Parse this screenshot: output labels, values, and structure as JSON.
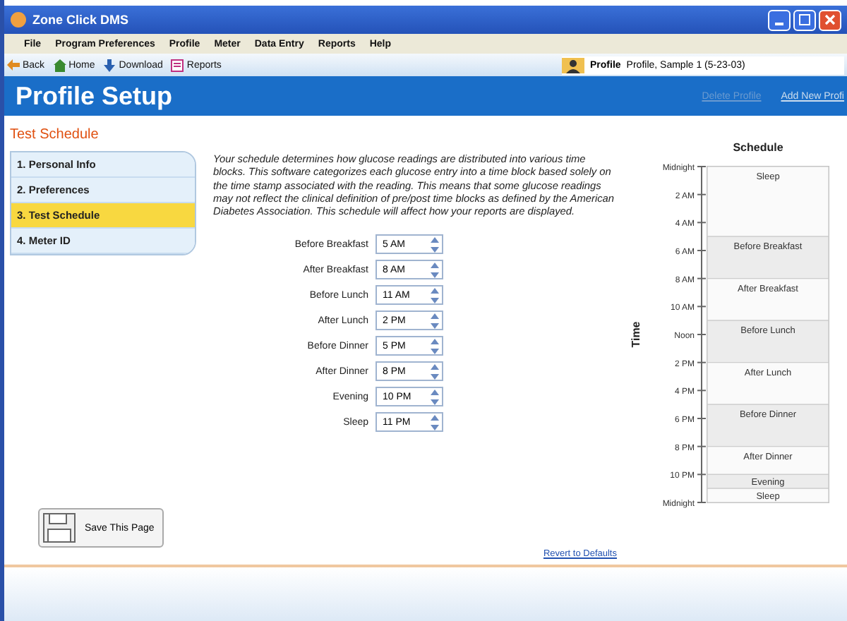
{
  "window": {
    "title": "Zone Click DMS"
  },
  "menu": [
    "File",
    "Program Preferences",
    "Profile",
    "Meter",
    "Data Entry",
    "Reports",
    "Help"
  ],
  "toolbar": {
    "buttons": [
      "Back",
      "Home",
      "Download",
      "Reports"
    ],
    "profile_label": "Profile",
    "profile_value": "Profile, Sample 1 (5-23-03)"
  },
  "header": {
    "title": "Profile Setup",
    "links": [
      {
        "label": "Delete Profile",
        "disabled": true
      },
      {
        "label": "Add New Profi",
        "disabled": false
      }
    ]
  },
  "section_title": "Test Schedule",
  "steps": [
    {
      "label": "1. Personal Info",
      "selected": false
    },
    {
      "label": "2. Preferences",
      "selected": false
    },
    {
      "label": "3. Test Schedule",
      "selected": true
    },
    {
      "label": "4. Meter ID",
      "selected": false
    }
  ],
  "description": "Your schedule determines how glucose readings are distributed into various time blocks.  This software categorizes each glucose entry into a time block based solely on the time stamp associated with the reading.  This means that some glucose readings may not reflect the clinical definition of pre/post time blocks as defined by the American Diabetes Association.  This schedule will affect how your reports are displayed.",
  "fields": [
    {
      "label": "Before Breakfast",
      "value": "5 AM"
    },
    {
      "label": "After Breakfast",
      "value": "8 AM"
    },
    {
      "label": "Before Lunch",
      "value": "11 AM"
    },
    {
      "label": "After Lunch",
      "value": "2 PM"
    },
    {
      "label": "Before Dinner",
      "value": "5 PM"
    },
    {
      "label": "After Dinner",
      "value": "8 PM"
    },
    {
      "label": "Evening",
      "value": "10 PM"
    },
    {
      "label": "Sleep",
      "value": "11 PM"
    }
  ],
  "save_button": "Save This Page",
  "revert_link": "Revert to Defaults",
  "schedule_chart": {
    "title": "Schedule",
    "axis_label": "Time",
    "ticks": [
      "Midnight",
      "2 AM",
      "4 AM",
      "6 AM",
      "8 AM",
      "10 AM",
      "Noon",
      "2 PM",
      "4 PM",
      "6 PM",
      "8 PM",
      "10 PM",
      "Midnight"
    ],
    "blocks": [
      "Sleep",
      "Before Breakfast",
      "After Breakfast",
      "Before Lunch",
      "After Lunch",
      "Before Dinner",
      "After Dinner",
      "Evening",
      "Sleep"
    ]
  }
}
